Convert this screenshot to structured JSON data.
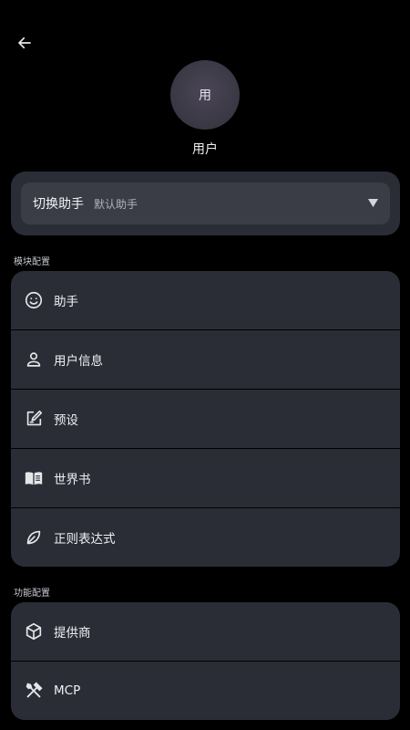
{
  "header": {
    "back_icon": "arrow-left-icon"
  },
  "profile": {
    "avatar_text": "用",
    "name": "用户"
  },
  "assistant_switch": {
    "label": "切换助手",
    "value": "默认助手",
    "icon": "dropdown-triangle-icon"
  },
  "module_section": {
    "title": "模块配置",
    "items": [
      {
        "label": "助手",
        "icon": "smiley-icon"
      },
      {
        "label": "用户信息",
        "icon": "person-icon"
      },
      {
        "label": "预设",
        "icon": "edit-note-icon"
      },
      {
        "label": "世界书",
        "icon": "book-icon"
      },
      {
        "label": "正则表达式",
        "icon": "leaf-icon"
      }
    ]
  },
  "function_section": {
    "title": "功能配置",
    "items": [
      {
        "label": "提供商",
        "icon": "cube-icon"
      },
      {
        "label": "MCP",
        "icon": "tools-icon"
      }
    ]
  },
  "colors": {
    "background": "#000000",
    "card": "#2b2d36",
    "field": "#3a3c46",
    "avatar": "#3f3c4a"
  }
}
